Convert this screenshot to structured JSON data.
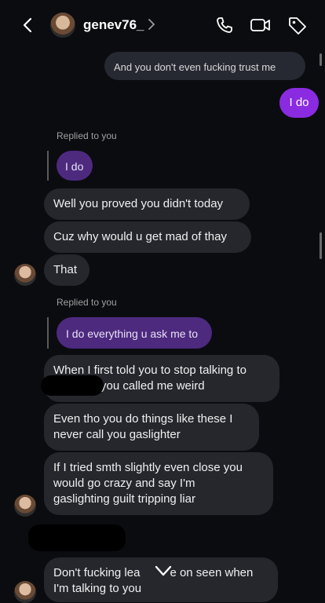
{
  "header": {
    "username": "genev76_",
    "chevron": ">"
  },
  "icons": {
    "back": "chevron-left-icon",
    "call": "phone-icon",
    "video": "video-camera-icon",
    "tag": "tag-icon",
    "scroll_down": "chevron-down-icon"
  },
  "messages": {
    "m1": "And you don't even fucking trust me",
    "m2": "I do",
    "replied_label_1": "Replied to you",
    "reply_quote_1": "I do",
    "m3": "Well you proved you didn't today",
    "m4": "Cuz why would u get mad of thay",
    "m5": "That",
    "replied_label_2": "Replied to you",
    "reply_quote_2": "I do everything u ask me to",
    "m6_line1": "When I first told you to stop talking to",
    "m6_line2": "you called me weird",
    "m7_line1": "Even tho you do things like these I",
    "m7_line2": "never call you gaslighter",
    "m8_line1": "If I tried smth slightly even close you",
    "m8_line2": "would go crazy and say I'm",
    "m8_line3": "gaslighting guilt tripping liar",
    "m9_line1_a": "Don't fucking lea",
    "m9_line1_b": "e on seen when",
    "m9_line2": "I'm talking to you"
  },
  "colors": {
    "background": "#0b0c10",
    "outgoing_purple": "#8a2be2",
    "incoming_bubble": "#26272d",
    "reply_quote_purple": "#4d2a7e"
  }
}
